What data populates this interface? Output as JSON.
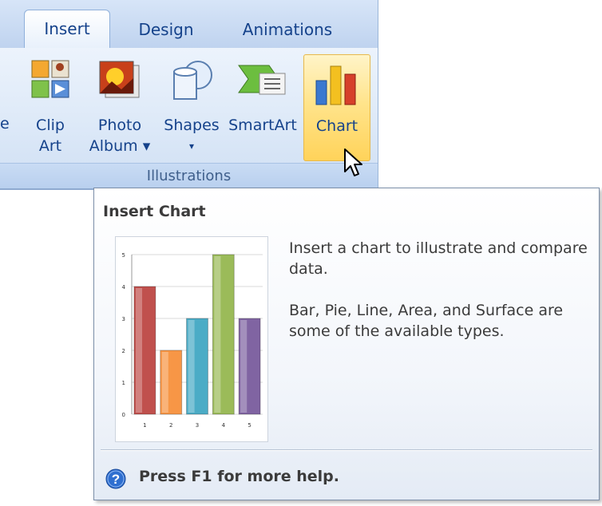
{
  "ribbon": {
    "tabs": [
      {
        "label": "Insert",
        "active": true
      },
      {
        "label": "Design"
      },
      {
        "label": "Animations"
      }
    ],
    "cut_label": "e",
    "buttons": {
      "clip_art": {
        "label_line1": "Clip",
        "label_line2": "Art",
        "icon": "clip-art-icon"
      },
      "photo_album": {
        "label_line1": "Photo",
        "label_line2": "Album ▾",
        "icon": "photo-album-icon"
      },
      "shapes": {
        "label_line1": "Shapes",
        "label_line2": "▾",
        "icon": "shapes-icon"
      },
      "smartart": {
        "label": "SmartArt",
        "icon": "smartart-icon"
      },
      "chart": {
        "label": "Chart",
        "icon": "chart-icon",
        "state": "hover"
      }
    },
    "group_label": "Illustrations"
  },
  "tooltip": {
    "title": "Insert Chart",
    "description1": "Insert a chart to illustrate and compare data.",
    "description2": "Bar, Pie, Line, Area, and Surface are some of the available types.",
    "help_text": "Press F1 for more help.",
    "help_icon": "help-icon"
  },
  "chart_data": {
    "type": "bar",
    "categories": [
      "1",
      "2",
      "3",
      "4",
      "5"
    ],
    "values": [
      4,
      2,
      3,
      5,
      3
    ],
    "colors": [
      "#c0504d",
      "#f79646",
      "#4bacc6",
      "#9bbb59",
      "#8064a2"
    ],
    "ylim": [
      0,
      5
    ],
    "yticks": [
      "0",
      "1",
      "2",
      "3",
      "4",
      "5"
    ],
    "grid": true
  },
  "colors": {
    "ribbon_text": "#15428b",
    "hover_fill": "#ffd35a"
  }
}
